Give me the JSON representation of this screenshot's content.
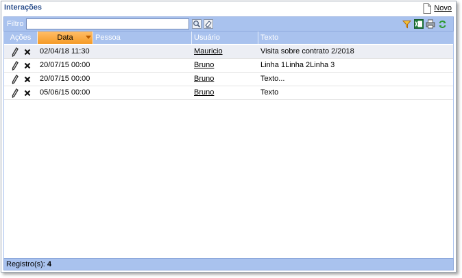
{
  "window": {
    "title": "Interações",
    "new_label": "Novo"
  },
  "filter": {
    "label": "Filtro",
    "value": ""
  },
  "columns": {
    "acoes": "Ações",
    "data": "Data",
    "pessoa": "Pessoa",
    "usuario": "Usuário",
    "texto": "Texto"
  },
  "rows": [
    {
      "data": "02/04/18 11:30",
      "pessoa": "",
      "usuario": "Mauricio",
      "texto": "Visita sobre contrato 2/2018"
    },
    {
      "data": "20/07/15 00:00",
      "pessoa": "",
      "usuario": "Bruno",
      "texto": "Linha 1Linha 2Linha 3"
    },
    {
      "data": "20/07/15 00:00",
      "pessoa": "",
      "usuario": "Bruno",
      "texto": "Texto..."
    },
    {
      "data": "05/06/15 00:00",
      "pessoa": "",
      "usuario": "Bruno",
      "texto": "Texto"
    }
  ],
  "footer": {
    "label": "Registro(s):",
    "count": "4"
  },
  "icons": {
    "new": "new-document-icon",
    "search": "magnifier-icon",
    "clear": "eraser-icon",
    "filter": "funnel-icon",
    "excel": "excel-icon",
    "print": "printer-icon",
    "refresh": "refresh-icon",
    "edit": "pencil-icon",
    "delete": "x-icon"
  },
  "colors": {
    "header_bg": "#a9c2ee",
    "sorted_header": "#f59a26",
    "title": "#2c4f8c"
  }
}
